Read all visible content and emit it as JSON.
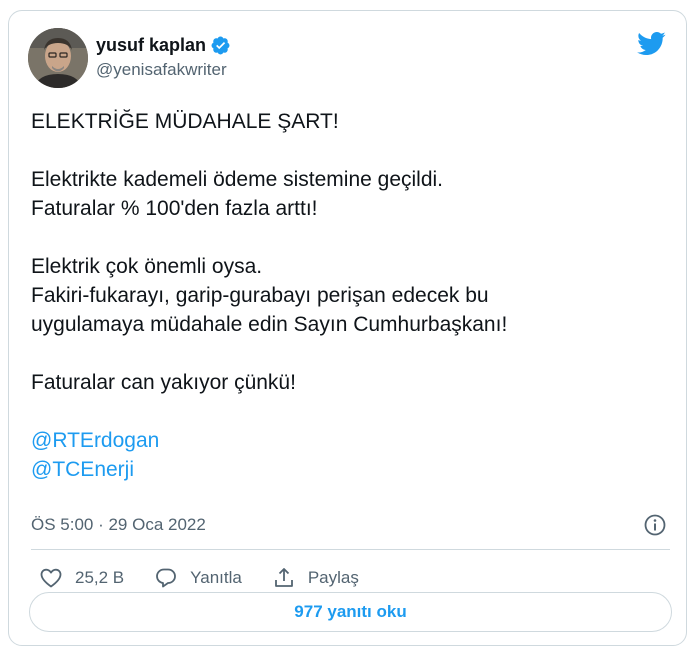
{
  "author": {
    "display_name": "yusuf kaplan",
    "handle": "@yenisafakwriter"
  },
  "tweet": {
    "lines": {
      "l1": "ELEKTRİĞE MÜDAHALE ŞART!",
      "l2": "Elektrikte kademeli ödeme sistemine geçildi.",
      "l3": "Faturalar % 100'den fazla arttı!",
      "l4": "Elektrik çok önemli oysa.",
      "l5": "Fakiri-fukarayı, garip-gurabayı perişan edecek bu",
      "l6": "uygulamaya müdahale edin Sayın Cumhurbaşkanı!",
      "l7": "Faturalar can yakıyor çünkü!"
    },
    "mentions": [
      "@RTErdogan",
      "@TCEnerji"
    ],
    "timestamp": "ÖS 5:00 · 29 Oca 2022"
  },
  "actions": {
    "like_count": "25,2 B",
    "reply_label": "Yanıtla",
    "share_label": "Paylaş"
  },
  "replies_button": {
    "label": "977 yanıtı oku"
  },
  "colors": {
    "accent": "#1d9bf0",
    "text": "#0f1419",
    "muted": "#536471",
    "border": "#cfd9de"
  }
}
